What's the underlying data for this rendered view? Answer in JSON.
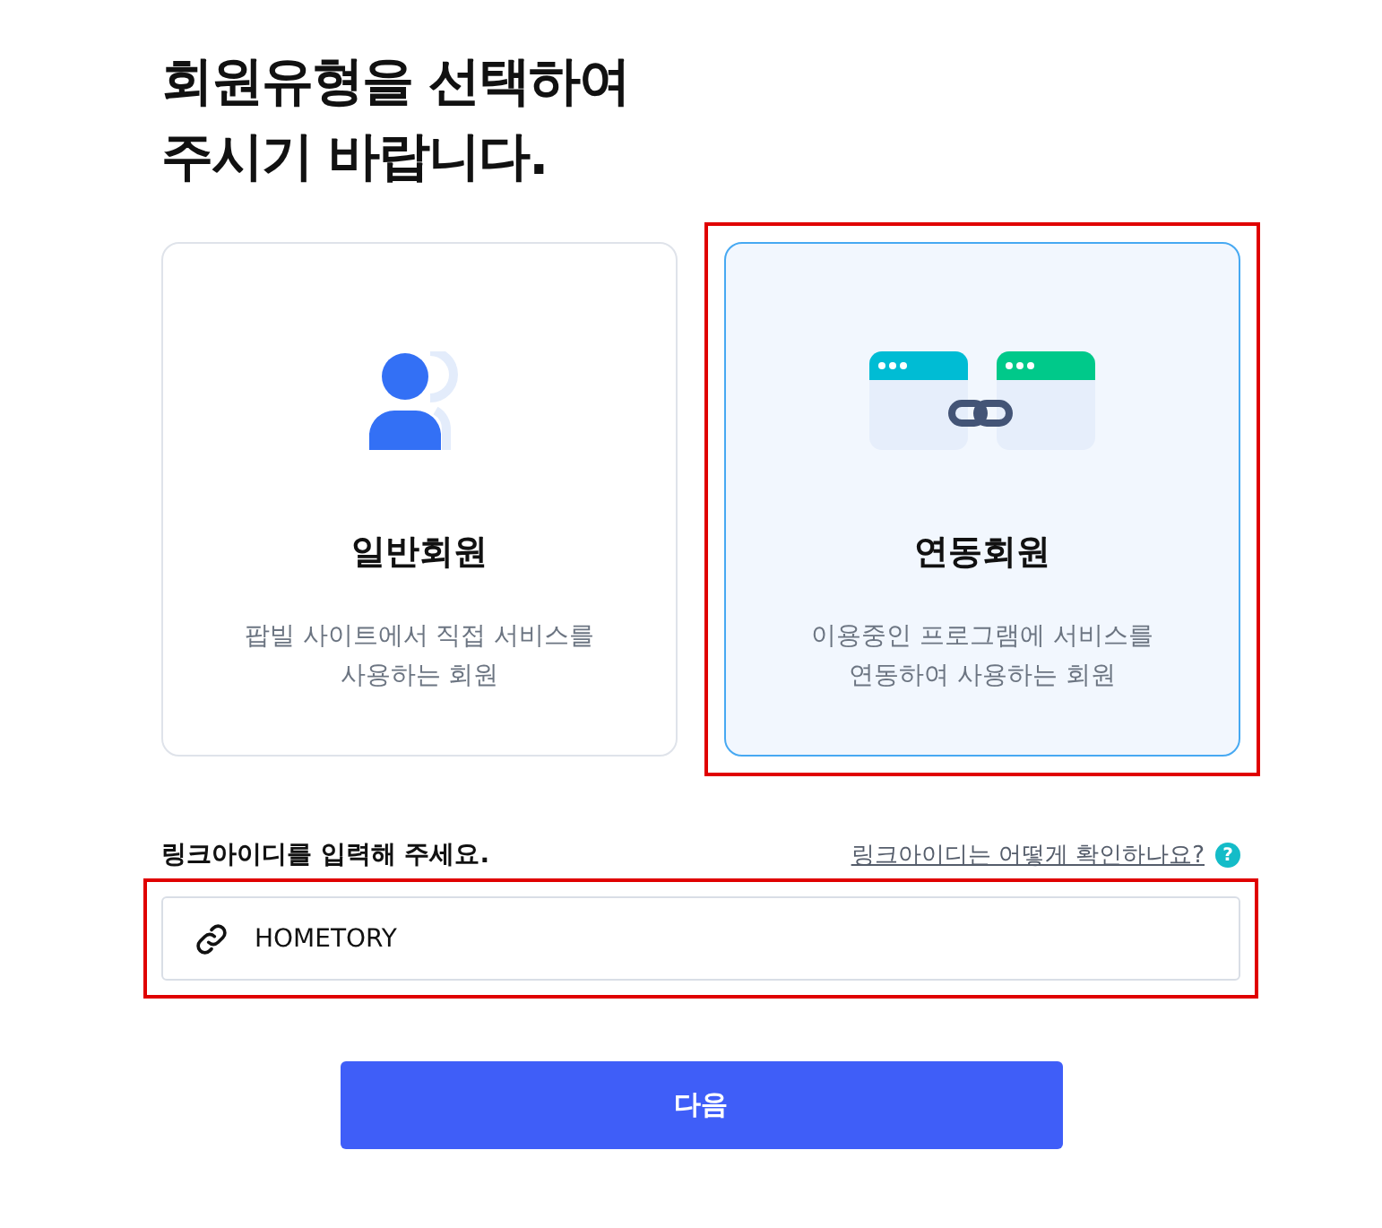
{
  "heading": [
    "회원유형을 선택하여",
    "주시기 바랍니다."
  ],
  "member_types": [
    {
      "kind": "person",
      "title": "일반회원",
      "description": [
        "팝빌 사이트에서 직접 서비스를",
        "사용하는 회원"
      ],
      "selected": false
    },
    {
      "kind": "linked",
      "title": "연동회원",
      "description": [
        "이용중인 프로그램에 서비스를",
        "연동하여 사용하는 회원"
      ],
      "selected": true
    }
  ],
  "link_id": {
    "label": "링크아이디를 입력해 주세요.",
    "help_link": "링크아이디는 어떻게 확인하나요?",
    "help_icon": "?",
    "value": "HOMETORY"
  },
  "next_button": "다음"
}
